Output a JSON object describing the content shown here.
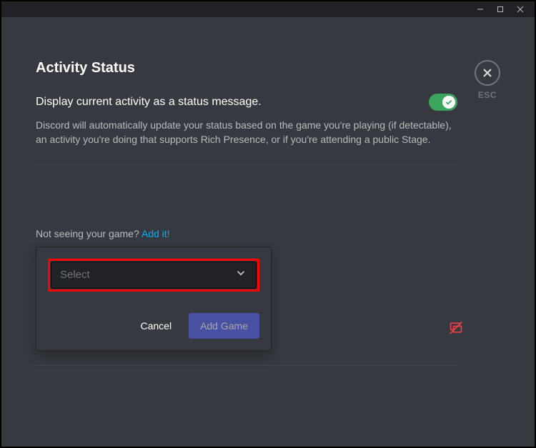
{
  "window": {
    "minimize": "−",
    "maximize": "□",
    "close": "×"
  },
  "close_button": {
    "esc_label": "ESC"
  },
  "page": {
    "title": "Activity Status",
    "setting_label": "Display current activity as a status message.",
    "setting_description": "Discord will automatically update your status based on the game you're playing (if detectable), an activity you're doing that supports Rich Presence, or if you're attending a public Stage.",
    "toggle_on": true
  },
  "game_section": {
    "hint_prefix": "Not seeing your game? ",
    "hint_link": "Add it!",
    "select_placeholder": "Select",
    "cancel_label": "Cancel",
    "add_label": "Add Game"
  },
  "colors": {
    "bg": "#36393f",
    "accent_green": "#3ba55d",
    "accent_blurple": "#5865f2",
    "highlight_red": "#ff0000"
  }
}
